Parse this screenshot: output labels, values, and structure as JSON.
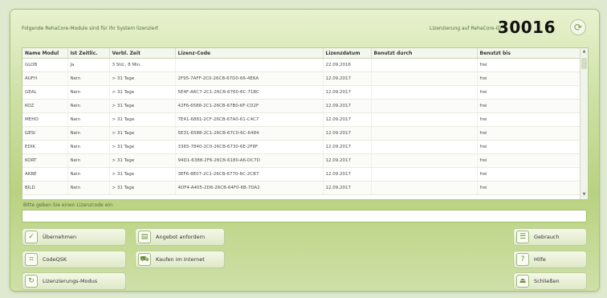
{
  "header": {
    "caption": "Folgende RehaCore-Module sind für Ihr System lizenziert",
    "license_number_label": "Lizenzierung auf RehaCore-ID",
    "license_number_value": "30016"
  },
  "table": {
    "columns": [
      "Name Modul",
      "Ist Zeitlic.",
      "Verbl. Zeit",
      "Lizenz-Code",
      "Lizenzdatum",
      "Benutzt durch",
      "Benutzt bis"
    ],
    "rows": [
      [
        "GLOB",
        "Ja",
        "3 Std., 8 Min.",
        "",
        "22.09.2016",
        "",
        "frei"
      ],
      [
        "AUFH",
        "Nein",
        "> 31 Tage",
        "2F95-7AFF-2C0-26CB-67D0-66-4E6A",
        "12.09.2017",
        "",
        "frei"
      ],
      [
        "GEAL",
        "Nein",
        "> 31 Tage",
        "5E4F-A6C7-2C1-26CB-6760-6C-71BC",
        "12.09.2017",
        "",
        "frei"
      ],
      [
        "KOZ",
        "Nein",
        "> 31 Tage",
        "42F6-6588-2C1-26CB-67B0-6F-CD2F",
        "12.09.2017",
        "",
        "frei"
      ],
      [
        "MEHO",
        "Nein",
        "> 31 Tage",
        "7E41-6881-2CF-26CB-67A0-61-C4C7",
        "12.09.2017",
        "",
        "frei"
      ],
      [
        "GESI",
        "Nein",
        "> 31 Tage",
        "5E31-6588-2C1-26CB-67C0-6C-6484",
        "12.09.2017",
        "",
        "frei"
      ],
      [
        "EDIK",
        "Nein",
        "> 31 Tage",
        "3365-7840-2C0-26CB-6730-6E-2F8F",
        "12.09.2017",
        "",
        "frei"
      ],
      [
        "KORT",
        "Nein",
        "> 31 Tage",
        "94D1-6388-2F6-26CB-6180-A6-DC7D",
        "12.09.2017",
        "",
        "frei"
      ],
      [
        "AKBE",
        "Nein",
        "> 31 Tage",
        "3EF6-8E07-2C1-26CB-6770-6C-2CB7",
        "12.09.2017",
        "",
        "frei"
      ],
      [
        "BILD",
        "Nein",
        "> 31 Tage",
        "4DF4-A405-2D6-26CB-64F0-6B-7DA2",
        "12.09.2017",
        "",
        "frei"
      ]
    ]
  },
  "input": {
    "prompt": "Bitte geben Sie einen Lizenzcode ein:",
    "value": "",
    "placeholder": ""
  },
  "buttons": {
    "uebernehmen": "Übernehmen",
    "codeqsk": "CodeQSK",
    "lizenzdialog": "Lizenzierungs-Modus",
    "angebot": "Angebot anfordern",
    "kaufen": "Kaufen im Internet",
    "gebrauch": "Gebrauch",
    "hilfe": "Hilfe",
    "schliessen": "Schließen"
  },
  "icons": {
    "refresh": "refresh-icon",
    "uebernehmen": "check-icon",
    "codeqsk": "code-icon",
    "lizenzdialog": "mode-icon",
    "angebot": "document-icon",
    "kaufen": "cart-icon",
    "gebrauch": "list-icon",
    "hilfe": "help-icon",
    "schliessen": "exit-icon"
  }
}
